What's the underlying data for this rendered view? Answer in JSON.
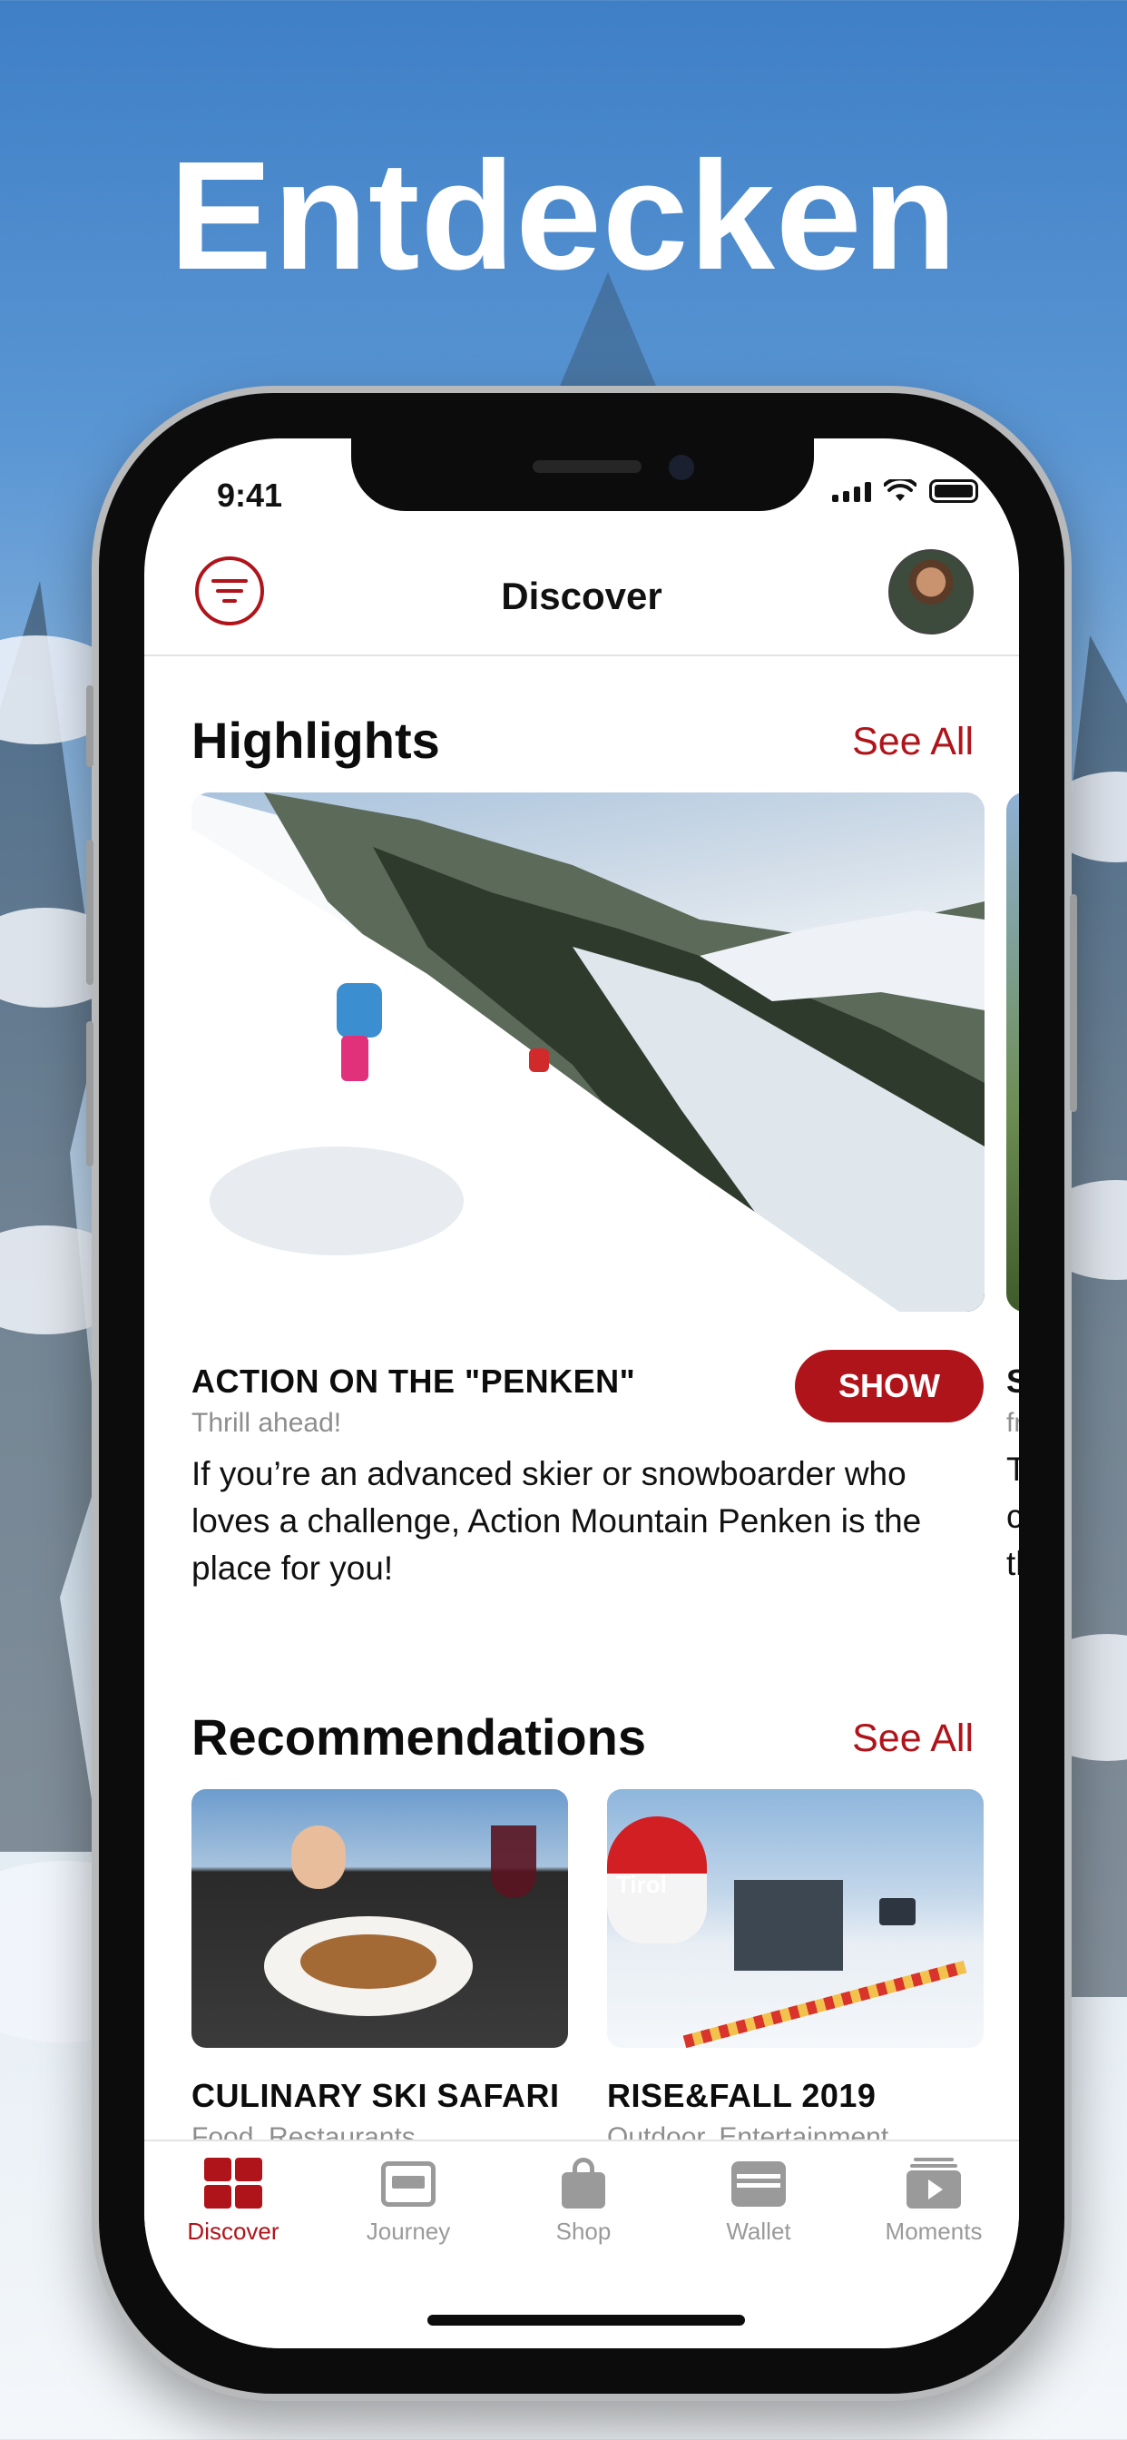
{
  "headline": "Entdecken",
  "status_bar": {
    "time": "9:41"
  },
  "nav": {
    "title": "Discover"
  },
  "highlights": {
    "title": "Highlights",
    "see_all": "See All",
    "card": {
      "title": "ACTION ON THE \"PENKEN\"",
      "subtitle": "Thrill ahead!",
      "button": "SHOW",
      "description": "If you’re an advanced skier or snowboarder who loves a challenge, Action Mountain Penken is the place for you!"
    },
    "peek": {
      "title": "S",
      "subtitle": "fr",
      "desc_line1": "T",
      "desc_line2": "c",
      "desc_line3": "th"
    }
  },
  "recommendations": {
    "title": "Recommendations",
    "see_all": "See All",
    "items": [
      {
        "title": "CULINARY SKI SAFARI",
        "subtitle": "Food, Restaurants"
      },
      {
        "title": "RISE&FALL 2019",
        "subtitle": "Outdoor, Entertainment"
      }
    ],
    "balloon_text": "Tirol"
  },
  "tabs": [
    {
      "label": "Discover",
      "icon": "grid-icon",
      "active": true
    },
    {
      "label": "Journey",
      "icon": "card-icon",
      "active": false
    },
    {
      "label": "Shop",
      "icon": "bag-icon",
      "active": false
    },
    {
      "label": "Wallet",
      "icon": "wallet-icon",
      "active": false
    },
    {
      "label": "Moments",
      "icon": "play-stack-icon",
      "active": false
    }
  ],
  "colors": {
    "accent": "#b0141b",
    "inactive": "#9a9a9a"
  }
}
